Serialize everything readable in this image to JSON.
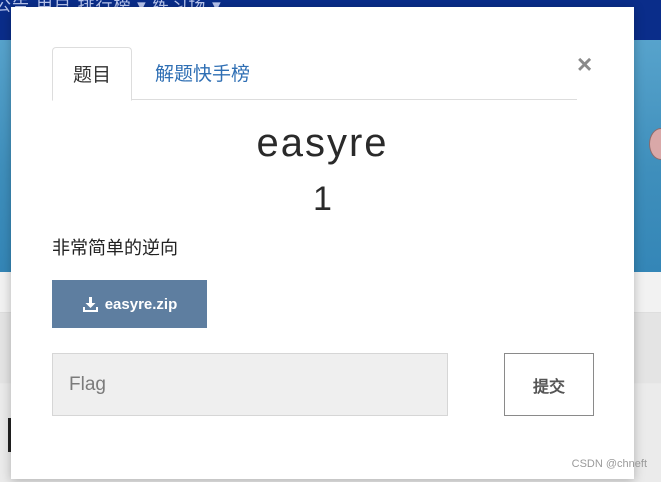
{
  "background": {
    "nav_text": "公告   用户   排行榜 ▾   练习场 ▾"
  },
  "modal": {
    "tabs": [
      {
        "label": "题目",
        "active": true
      },
      {
        "label": "解题快手榜",
        "active": false
      }
    ],
    "close_label": "×",
    "challenge": {
      "name": "easyre",
      "value": "1",
      "description": "非常简单的逆向"
    },
    "download": {
      "label": "easyre.zip",
      "icon": "download-icon"
    },
    "flag_input": {
      "placeholder": "Flag",
      "value": ""
    },
    "submit_label": "提交"
  },
  "watermark": "CSDN @chneft",
  "colors": {
    "nav": "#0a2d8a",
    "tab_link": "#2f6fb4",
    "download_button": "#5e7ea0"
  }
}
